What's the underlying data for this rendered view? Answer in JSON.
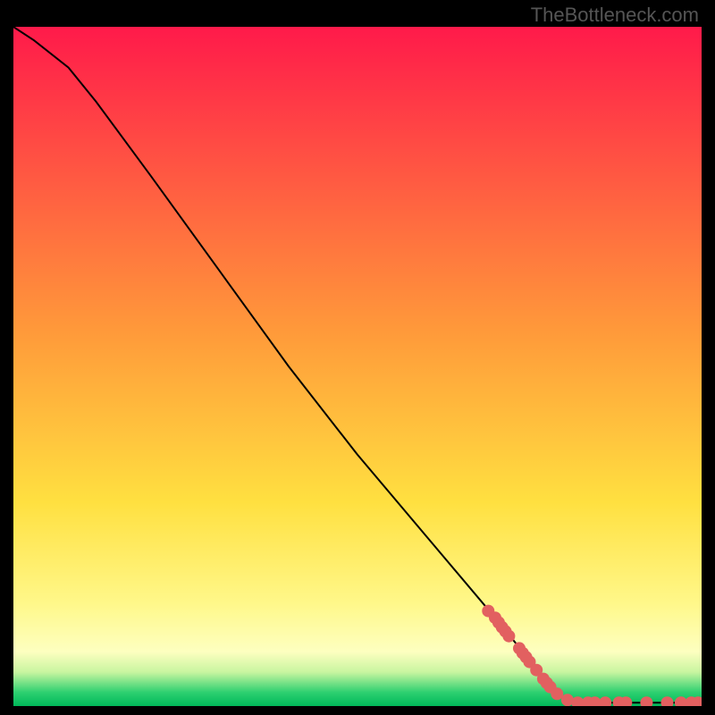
{
  "watermark": "TheBottleneck.com",
  "chart_data": {
    "type": "line",
    "title": "",
    "xlabel": "",
    "ylabel": "",
    "xlim": [
      0,
      100
    ],
    "ylim": [
      0,
      100
    ],
    "background_gradient": {
      "stops": [
        {
          "offset": 0,
          "color": "#ff1a4a"
        },
        {
          "offset": 45,
          "color": "#ff9a3a"
        },
        {
          "offset": 70,
          "color": "#ffe040"
        },
        {
          "offset": 85,
          "color": "#fff88a"
        },
        {
          "offset": 92,
          "color": "#fdffc0"
        },
        {
          "offset": 95,
          "color": "#c8f5a0"
        },
        {
          "offset": 98,
          "color": "#2dd070"
        },
        {
          "offset": 100,
          "color": "#00b85a"
        }
      ]
    },
    "curve": [
      {
        "x": 0,
        "y": 100
      },
      {
        "x": 3,
        "y": 98
      },
      {
        "x": 8,
        "y": 94
      },
      {
        "x": 12,
        "y": 89
      },
      {
        "x": 20,
        "y": 78
      },
      {
        "x": 30,
        "y": 64
      },
      {
        "x": 40,
        "y": 50
      },
      {
        "x": 50,
        "y": 37
      },
      {
        "x": 60,
        "y": 25
      },
      {
        "x": 70,
        "y": 13
      },
      {
        "x": 78,
        "y": 3
      },
      {
        "x": 80,
        "y": 1
      },
      {
        "x": 82,
        "y": 0.5
      },
      {
        "x": 100,
        "y": 0.5
      }
    ],
    "marker_color": "#e26060",
    "markers": [
      {
        "x": 69,
        "y": 14
      },
      {
        "x": 70,
        "y": 13
      },
      {
        "x": 70.5,
        "y": 12.3
      },
      {
        "x": 71,
        "y": 11.6
      },
      {
        "x": 71.5,
        "y": 11
      },
      {
        "x": 72,
        "y": 10.3
      },
      {
        "x": 73.5,
        "y": 8.5
      },
      {
        "x": 74,
        "y": 7.8
      },
      {
        "x": 74.5,
        "y": 7.2
      },
      {
        "x": 75,
        "y": 6.5
      },
      {
        "x": 76,
        "y": 5.3
      },
      {
        "x": 77,
        "y": 4
      },
      {
        "x": 77.5,
        "y": 3.4
      },
      {
        "x": 78,
        "y": 2.8
      },
      {
        "x": 79,
        "y": 1.8
      },
      {
        "x": 80.5,
        "y": 0.9
      },
      {
        "x": 82,
        "y": 0.5
      },
      {
        "x": 83.5,
        "y": 0.5
      },
      {
        "x": 84.5,
        "y": 0.5
      },
      {
        "x": 86,
        "y": 0.5
      },
      {
        "x": 88,
        "y": 0.5
      },
      {
        "x": 89,
        "y": 0.5
      },
      {
        "x": 92,
        "y": 0.5
      },
      {
        "x": 95,
        "y": 0.5
      },
      {
        "x": 97,
        "y": 0.5
      },
      {
        "x": 98.5,
        "y": 0.5
      },
      {
        "x": 99.5,
        "y": 0.5
      }
    ]
  }
}
